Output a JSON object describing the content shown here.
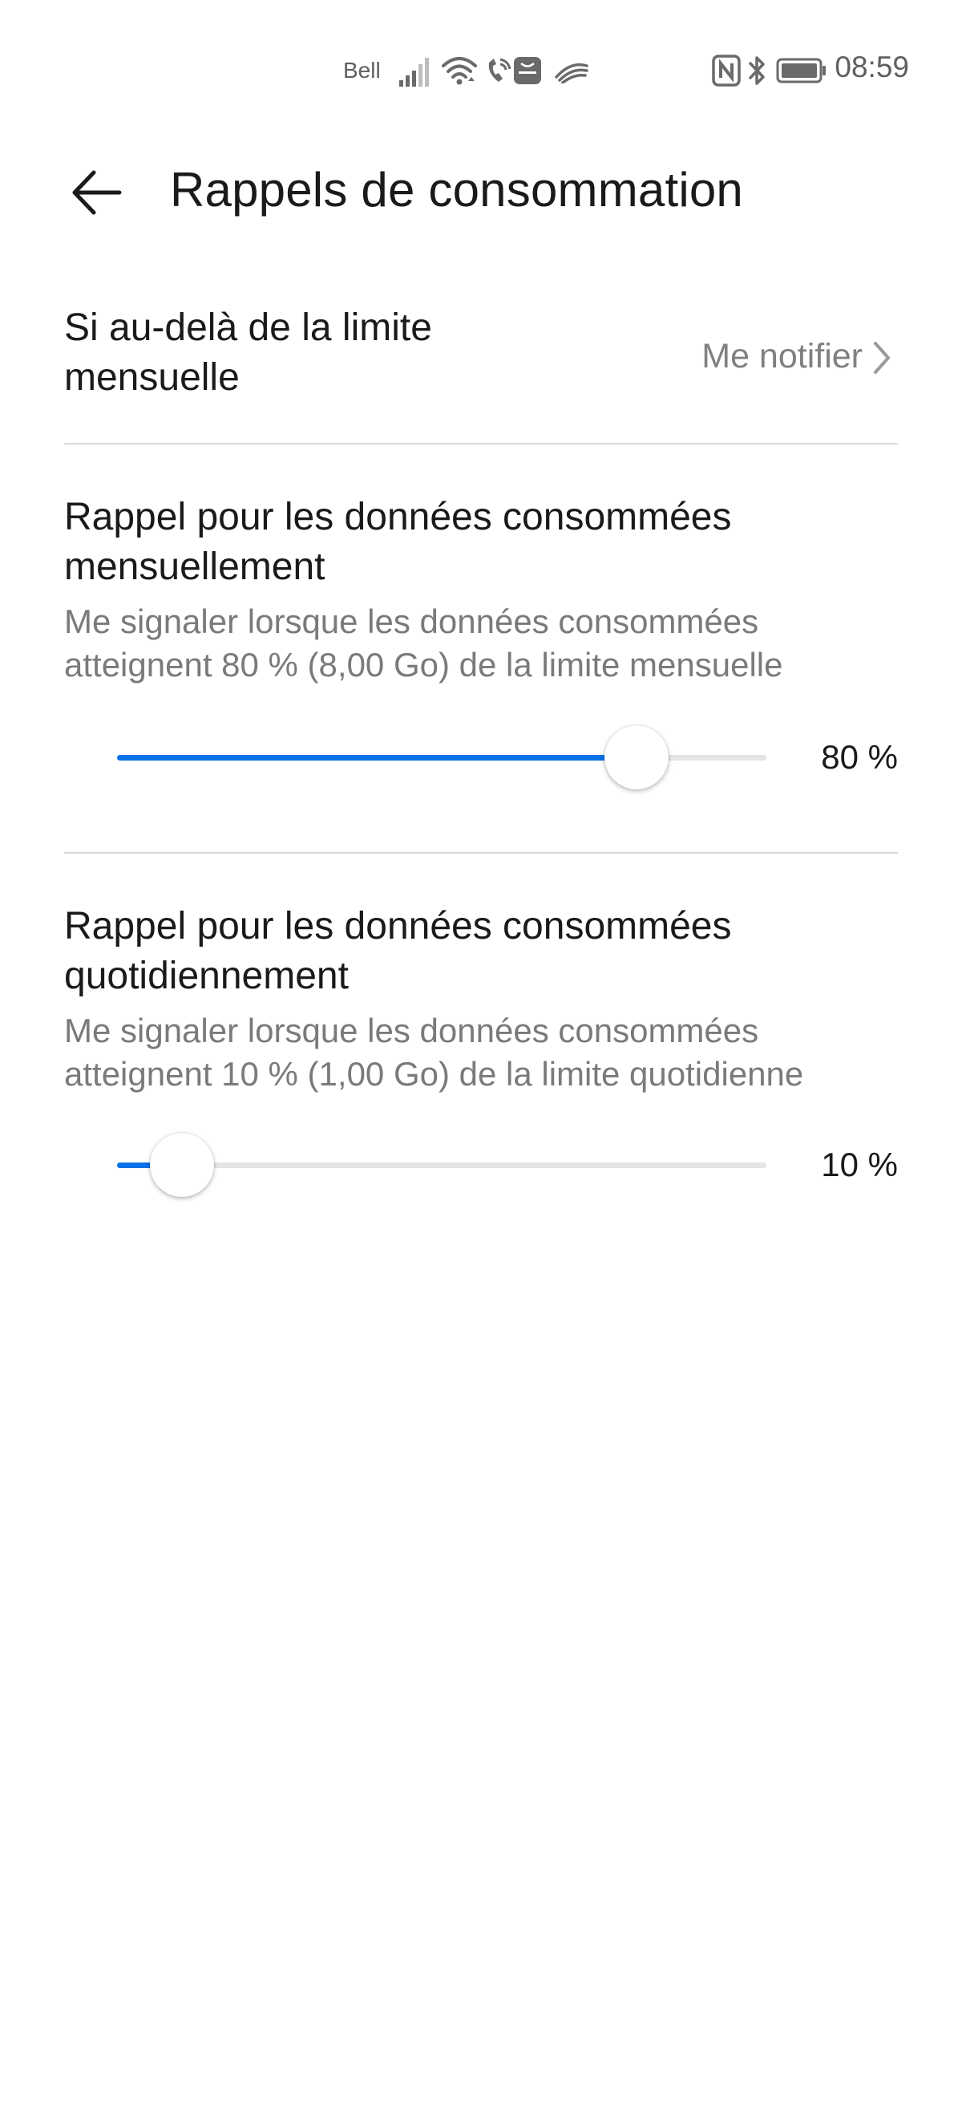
{
  "status_bar": {
    "carrier": "Bell",
    "time": "08:59",
    "icons": [
      "signal-icon",
      "wifi-icon",
      "wifi-calling-icon",
      "huawei-app-icon",
      "swipe-icon",
      "nfc-icon",
      "bluetooth-icon",
      "battery-icon"
    ]
  },
  "header": {
    "back_icon": "arrow-left-icon",
    "title": "Rappels de consommation"
  },
  "limit_row": {
    "label": "Si au-delà de la limite mensuelle",
    "value": "Me notifier",
    "icon": "chevron-right-icon"
  },
  "monthly": {
    "title": "Rappel pour les données consommées mensuellement",
    "description": "Me signaler lorsque les données consommées atteignent 80 % (8,00  Go) de la limite mensuelle",
    "value_label": "80 %",
    "value": 0.8
  },
  "daily": {
    "title": "Rappel pour les données consommées quotidiennement",
    "description": "Me signaler lorsque les données consommées atteignent 10 % (1,00  Go) de la limite quotidienne",
    "value_label": "10 %",
    "value": 0.1
  },
  "colors": {
    "accent": "#0a72e8",
    "track": "#e5e5e5",
    "secondary_text": "#7a7a7a",
    "primary_text": "#1a1a1a"
  }
}
